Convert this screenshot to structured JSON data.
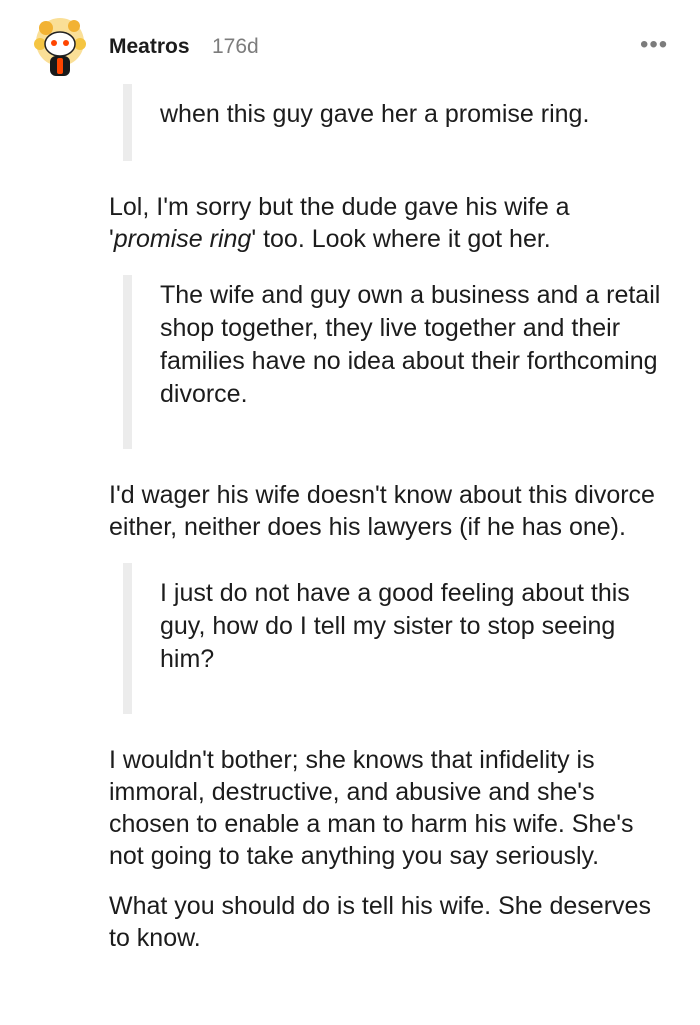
{
  "comment": {
    "username": "Meatros",
    "age": "176d",
    "more_label": "•••",
    "avatar_icon": "snoo-avatar-icon",
    "blocks": [
      {
        "type": "quote",
        "text": "when this guy gave her a promise ring."
      },
      {
        "type": "para",
        "before": "Lol, I'm sorry but the dude gave his wife a '",
        "em": "promise ring",
        "after": "' too. Look where it got her."
      },
      {
        "type": "quote",
        "text": "The wife and guy own a business and a retail shop together, they live together and their families have no idea about their forthcoming divorce."
      },
      {
        "type": "para",
        "text": "I'd wager his wife doesn't know about this divorce either, neither does his lawyers (if he has one)."
      },
      {
        "type": "quote",
        "text": "I just do not have a good feeling about this guy, how do I tell my sister to stop seeing him?"
      },
      {
        "type": "para",
        "text": "I wouldn't bother; she knows that infidelity is immoral, destructive, and abusive and she's chosen to enable a man to harm his wife. She's not going to take anything you say seriously."
      },
      {
        "type": "para",
        "text": "What you should do is tell his wife. She deserves to know."
      }
    ]
  },
  "colors": {
    "quote_bar": "#ececec",
    "text": "#1c1c1c",
    "muted": "#7c7c7c"
  }
}
